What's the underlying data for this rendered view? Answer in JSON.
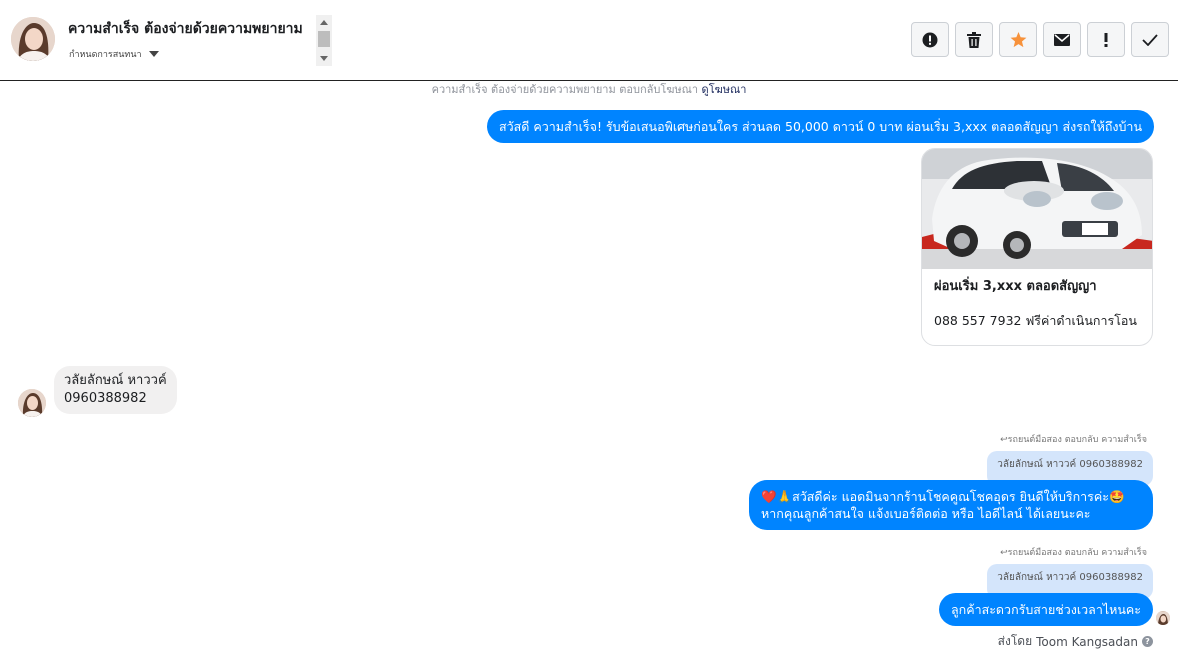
{
  "header": {
    "title": "ความสำเร็จ ต้องจ่ายด้วยความพยายาม",
    "label_dropdown": "กำหนดการสนทนา",
    "actions": [
      {
        "name": "mark-spam",
        "icon": "alert-circle-icon"
      },
      {
        "name": "delete",
        "icon": "trash-icon"
      },
      {
        "name": "star",
        "icon": "star-icon"
      },
      {
        "name": "mark-unread",
        "icon": "envelope-icon"
      },
      {
        "name": "important",
        "icon": "exclamation-icon"
      },
      {
        "name": "done",
        "icon": "check-icon"
      }
    ],
    "star_color": "#f7923b"
  },
  "ad_note": {
    "text": "ความสำเร็จ ต้องจ่ายด้วยความพยายาม ตอบกลับโฆษณา",
    "link": "ดูโฆษณา"
  },
  "messages": {
    "greeting": "สวัสดี ความสำเร็จ! รับข้อเสนอพิเศษก่อนใคร ส่วนลด 50,000 ดาวน์ 0 บาท ผ่อนเริ่ม 3,xxx ตลอดสัญญา ส่งรถให้ถึงบ้าน",
    "card_title": "ผ่อนเริ่ม 3,xxx ตลอดสัญญา",
    "card_subtitle": "088 557 7932 ฟรีค่าดำเนินการโอน",
    "customer_line1": "วลัยลักษณ์  หาววค์",
    "customer_line2": "0960388982",
    "reply_meta_1": "รถยนต์มือสอง ตอบกลับ ความสำเร็จ",
    "quote_1": "วลัยลักษณ์ หาววค์ 0960388982",
    "reply1_line1": "❤️🙏สวัสดีค่ะ แอดมินจากร้านโชคคูณโชคอุดร ยินดีให้บริการค่ะ🤩",
    "reply1_line2": "หากคุณลูกค้าสนใจ แจ้งเบอร์ติดต่อ หรือ ไอดีไลน์ ได้เลยนะคะ",
    "reply_meta_2": "รถยนต์มือสอง ตอบกลับ ความสำเร็จ",
    "quote_2": "วลัยลักษณ์ หาววค์ 0960388982",
    "reply2": "ลูกค้าสะดวกรับสายช่วงเวลาไหนคะ"
  },
  "footer": {
    "sent_by_prefix": "ส่งโดย",
    "sent_by_name": "Toom Kangsadan"
  },
  "colors": {
    "bubble_blue": "#0084ff",
    "quote_bg": "#d4e5fb",
    "incoming_bg": "#f1f0f0"
  }
}
